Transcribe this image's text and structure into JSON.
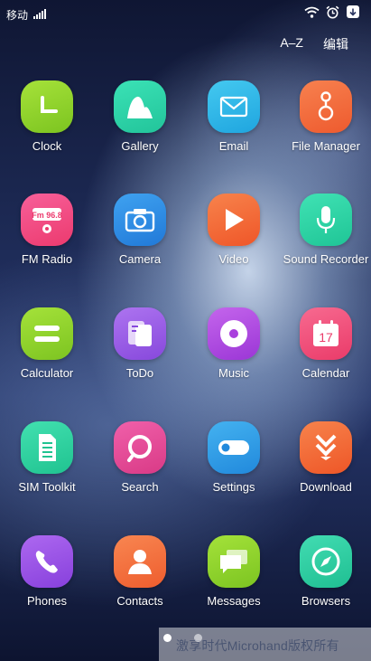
{
  "status_bar": {
    "carrier": "移动"
  },
  "top_actions": {
    "sort": "A–Z",
    "edit": "编辑"
  },
  "apps": [
    {
      "label": "Clock",
      "icon": "clock-icon"
    },
    {
      "label": "Gallery",
      "icon": "gallery-icon"
    },
    {
      "label": "Email",
      "icon": "email-icon"
    },
    {
      "label": "File Manager",
      "icon": "file-manager-icon"
    },
    {
      "label": "FM Radio",
      "icon": "fm-radio-icon",
      "badge": "Fm 96.8"
    },
    {
      "label": "Camera",
      "icon": "camera-icon"
    },
    {
      "label": "Video",
      "icon": "video-play-icon"
    },
    {
      "label": "Sound Recorder",
      "icon": "microphone-icon"
    },
    {
      "label": "Calculator",
      "icon": "calculator-icon"
    },
    {
      "label": "ToDo",
      "icon": "todo-icon"
    },
    {
      "label": "Music",
      "icon": "music-icon"
    },
    {
      "label": "Calendar",
      "icon": "calendar-icon",
      "badge": "17"
    },
    {
      "label": "SIM Toolkit",
      "icon": "sim-card-icon"
    },
    {
      "label": "Search",
      "icon": "search-icon"
    },
    {
      "label": "Settings",
      "icon": "settings-toggle-icon"
    },
    {
      "label": "Download",
      "icon": "download-icon"
    },
    {
      "label": "Phones",
      "icon": "phone-icon"
    },
    {
      "label": "Contacts",
      "icon": "contacts-icon"
    },
    {
      "label": "Messages",
      "icon": "messages-icon"
    },
    {
      "label": "Browsers",
      "icon": "compass-icon"
    }
  ],
  "page_indicator": {
    "pages": 2,
    "current": 1
  },
  "watermark": "激享时代Microhand版权所有",
  "colors": {
    "clock": "#8fd22c",
    "gallery": "#2fd4a8",
    "email": "#2cb8e8",
    "file_manager": "#f36a3c",
    "fm_radio": "#f2487e",
    "camera": "#2e8fe6",
    "video": "#f26a3a",
    "sound_recorder": "#2ed6a6",
    "calculator": "#8ed12e",
    "todo": "#9a5fe8",
    "music": "#b04ee0",
    "calendar": "#f04f7a",
    "sim_toolkit": "#2fd49e",
    "search": "#e84c9a",
    "settings": "#2f9ee8",
    "download": "#f2683a",
    "phones": "#9a4ee8",
    "contacts": "#f5703a",
    "messages": "#8ed22e",
    "browsers": "#2dcaa0"
  }
}
